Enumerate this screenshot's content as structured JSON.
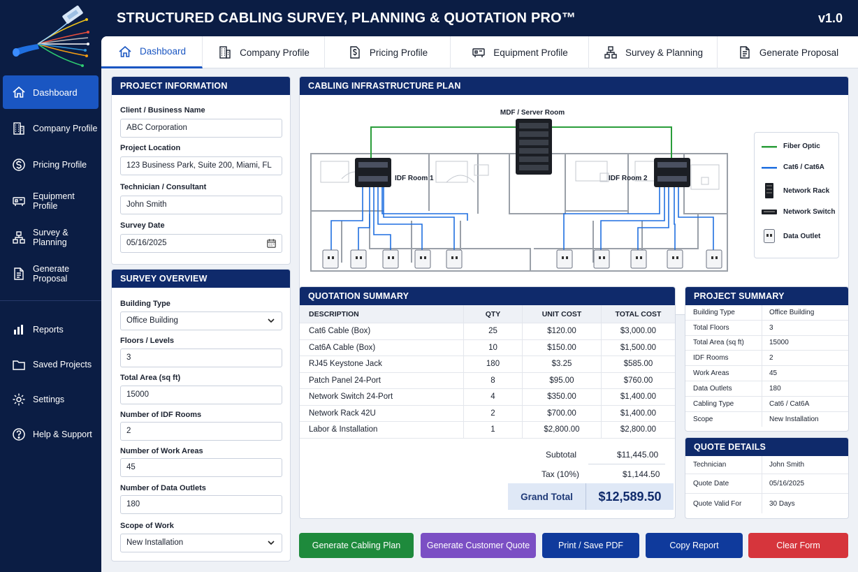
{
  "app": {
    "title": "STRUCTURED CABLING SURVEY, PLANNING & QUOTATION PRO™",
    "version": "v1.0"
  },
  "sidebar": {
    "items": [
      {
        "label": "Dashboard",
        "icon": "home-icon",
        "active": true
      },
      {
        "label": "Company Profile",
        "icon": "building-icon"
      },
      {
        "label": "Pricing Profile",
        "icon": "dollar-icon"
      },
      {
        "label": "Equipment Profile",
        "icon": "equipment-icon"
      },
      {
        "label": "Survey & Planning",
        "icon": "network-icon"
      },
      {
        "label": "Generate Proposal",
        "icon": "document-icon"
      }
    ],
    "secondary": [
      {
        "label": "Reports",
        "icon": "bar-chart-icon"
      },
      {
        "label": "Saved Projects",
        "icon": "folder-icon"
      },
      {
        "label": "Settings",
        "icon": "gear-icon"
      },
      {
        "label": "Help & Support",
        "icon": "help-icon"
      }
    ]
  },
  "tabs": [
    {
      "label": "Dashboard",
      "icon": "home-icon",
      "active": true
    },
    {
      "label": "Company Profile",
      "icon": "building-icon"
    },
    {
      "label": "Pricing Profile",
      "icon": "dollar-doc-icon"
    },
    {
      "label": "Equipment Profile",
      "icon": "equipment-icon"
    },
    {
      "label": "Survey & Planning",
      "icon": "network-icon"
    },
    {
      "label": "Generate Proposal",
      "icon": "document-icon"
    }
  ],
  "project_info": {
    "title": "PROJECT INFORMATION",
    "client_label": "Client / Business Name",
    "client": "ABC Corporation",
    "location_label": "Project Location",
    "location": "123 Business Park, Suite 200, Miami, FL",
    "tech_label": "Technician / Consultant",
    "tech": "John Smith",
    "date_label": "Survey Date",
    "date": "05/16/2025"
  },
  "survey": {
    "title": "SURVEY OVERVIEW",
    "building_label": "Building Type",
    "building": "Office Building",
    "floors_label": "Floors / Levels",
    "floors": "3",
    "area_label": "Total Area (sq ft)",
    "area": "15000",
    "idf_label": "Number of IDF Rooms",
    "idf": "2",
    "work_label": "Number of Work Areas",
    "work": "45",
    "outlets_label": "Number of Data Outlets",
    "outlets": "180",
    "scope_label": "Scope of Work",
    "scope": "New Installation"
  },
  "plan": {
    "title": "CABLING INFRASTRUCTURE PLAN",
    "mdf_label": "MDF / Server Room",
    "idf1_label": "IDF Room 1",
    "idf2_label": "IDF Room 2",
    "legend": [
      {
        "label": "Fiber Optic",
        "color": "#2a9d3a"
      },
      {
        "label": "Cat6 / Cat6A",
        "color": "#1f6fe0"
      },
      {
        "label": "Network Rack"
      },
      {
        "label": "Network Switch"
      },
      {
        "label": "Data Outlet"
      }
    ]
  },
  "quotation": {
    "title": "QUOTATION SUMMARY",
    "headers": [
      "DESCRIPTION",
      "QTY",
      "UNIT COST",
      "TOTAL COST"
    ],
    "rows": [
      [
        "Cat6 Cable (Box)",
        "25",
        "$120.00",
        "$3,000.00"
      ],
      [
        "Cat6A Cable (Box)",
        "10",
        "$150.00",
        "$1,500.00"
      ],
      [
        "RJ45 Keystone Jack",
        "180",
        "$3.25",
        "$585.00"
      ],
      [
        "Patch Panel 24-Port",
        "8",
        "$95.00",
        "$760.00"
      ],
      [
        "Network Switch 24-Port",
        "4",
        "$350.00",
        "$1,400.00"
      ],
      [
        "Network Rack 42U",
        "2",
        "$700.00",
        "$1,400.00"
      ],
      [
        "Labor & Installation",
        "1",
        "$2,800.00",
        "$2,800.00"
      ]
    ],
    "subtotal_label": "Subtotal",
    "subtotal": "$11,445.00",
    "tax_label": "Tax (10%)",
    "tax": "$1,144.50",
    "grand_label": "Grand Total",
    "grand": "$12,589.50"
  },
  "project_summary": {
    "title": "PROJECT SUMMARY",
    "rows": [
      [
        "Building Type",
        "Office Building"
      ],
      [
        "Total Floors",
        "3"
      ],
      [
        "Total Area (sq ft)",
        "15000"
      ],
      [
        "IDF Rooms",
        "2"
      ],
      [
        "Work Areas",
        "45"
      ],
      [
        "Data Outlets",
        "180"
      ],
      [
        "Cabling Type",
        "Cat6 / Cat6A"
      ],
      [
        "Scope",
        "New Installation"
      ]
    ]
  },
  "quote_details": {
    "title": "QUOTE DETAILS",
    "rows": [
      [
        "Technician",
        "John Smith"
      ],
      [
        "Quote Date",
        "05/16/2025"
      ],
      [
        "Quote Valid For",
        "30 Days"
      ]
    ]
  },
  "buttons": [
    {
      "label": "Generate Cabling Plan",
      "color": "#1e8a3c"
    },
    {
      "label": "Generate Customer Quote",
      "color": "#7b4fc4"
    },
    {
      "label": "Print / Save PDF",
      "color": "#0f3a9c"
    },
    {
      "label": "Copy Report",
      "color": "#0f3a9c"
    },
    {
      "label": "Clear Form",
      "color": "#d6353c"
    }
  ]
}
